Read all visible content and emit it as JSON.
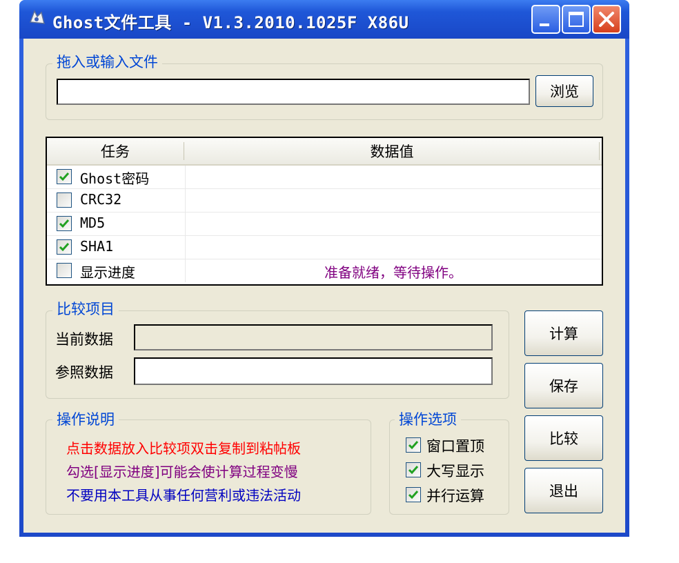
{
  "window": {
    "title": "Ghost文件工具 - V1.3.2010.1025F X86U"
  },
  "file_group": {
    "label": "拖入或输入文件",
    "input_value": "",
    "browse_label": "浏览"
  },
  "task_list": {
    "columns": [
      "任务",
      "数据值"
    ],
    "rows": [
      {
        "label": "Ghost密码",
        "checked": true,
        "value": ""
      },
      {
        "label": "CRC32",
        "checked": false,
        "value": ""
      },
      {
        "label": "MD5",
        "checked": true,
        "value": ""
      },
      {
        "label": "SHA1",
        "checked": true,
        "value": ""
      },
      {
        "label": "显示进度",
        "checked": false,
        "value": "准备就绪，等待操作。"
      }
    ]
  },
  "compare_group": {
    "label": "比较项目",
    "current_label": "当前数据",
    "current_value": "",
    "reference_label": "参照数据",
    "reference_value": ""
  },
  "instructions_group": {
    "label": "操作说明",
    "lines": [
      {
        "text": "点击数据放入比较项双击复制到粘帖板",
        "color": "#ff0000"
      },
      {
        "text": "勾选[显示进度]可能会使计算过程变慢",
        "color": "#800080"
      },
      {
        "text": "不要用本工具从事任何营利或违法活动",
        "color": "#0000c0"
      }
    ]
  },
  "options_group": {
    "label": "操作选项",
    "options": [
      {
        "label": "窗口置顶",
        "checked": true
      },
      {
        "label": "大写显示",
        "checked": true
      },
      {
        "label": "并行运算",
        "checked": true
      }
    ]
  },
  "actions": {
    "calculate": "计算",
    "save": "保存",
    "compare": "比较",
    "exit": "退出"
  },
  "colors": {
    "titlebar": "#1f57d8",
    "window_bg": "#ece9d8",
    "group_label": "#0046d5",
    "checkmark": "#21a121"
  }
}
